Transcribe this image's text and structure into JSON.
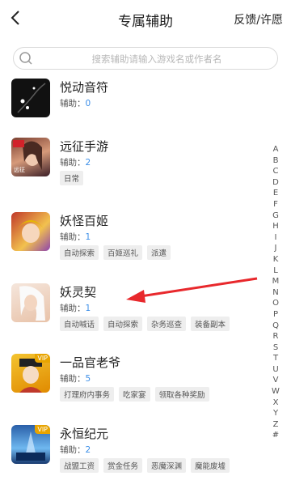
{
  "header": {
    "title": "专属辅助",
    "right_link": "反馈/许愿"
  },
  "search": {
    "placeholder": "搜索辅助请输入游戏名或作者名"
  },
  "items": [
    {
      "name": "悦动音符",
      "assist_label": "辅助：",
      "count": "0",
      "tags": []
    },
    {
      "name": "远征手游",
      "assist_label": "辅助：",
      "count": "2",
      "tags": [
        "日常"
      ]
    },
    {
      "name": "妖怪百姬",
      "assist_label": "辅助：",
      "count": "1",
      "tags": [
        "自动探索",
        "百姬巡礼",
        "派遣"
      ]
    },
    {
      "name": "妖灵契",
      "assist_label": "辅助：",
      "count": "1",
      "tags": [
        "自动喊话",
        "自动探索",
        "杂务巡查",
        "装备副本"
      ]
    },
    {
      "name": "一品官老爷",
      "assist_label": "辅助：",
      "count": "5",
      "tags": [
        "打理府内事务",
        "吃家宴",
        "领取各种奖励"
      ]
    },
    {
      "name": "永恒纪元",
      "assist_label": "辅助：",
      "count": "2",
      "tags": [
        "战盟工资",
        "赏金任务",
        "恶魔深渊",
        "魔能废墟"
      ]
    }
  ],
  "icon_texts": {
    "vip": "VIP",
    "yuanzheng": "远征"
  },
  "alphabet": [
    "A",
    "B",
    "C",
    "D",
    "E",
    "F",
    "G",
    "H",
    "I",
    "J",
    "K",
    "L",
    "M",
    "N",
    "O",
    "P",
    "Q",
    "R",
    "S",
    "T",
    "U",
    "V",
    "W",
    "X",
    "Y",
    "Z",
    "#"
  ],
  "colors": {
    "accent": "#3b8ee8",
    "arrow": "#e8282c"
  }
}
